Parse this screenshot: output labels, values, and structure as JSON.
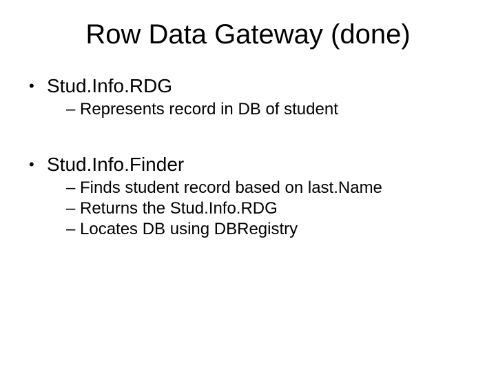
{
  "title": "Row Data Gateway (done)",
  "bullets": [
    {
      "label": "Stud.Info.RDG",
      "sub": [
        "Represents record in DB of student"
      ]
    },
    {
      "label": "Stud.Info.Finder",
      "sub": [
        "Finds student record based on last.Name",
        "Returns the Stud.Info.RDG",
        "Locates DB using DBRegistry"
      ]
    }
  ]
}
